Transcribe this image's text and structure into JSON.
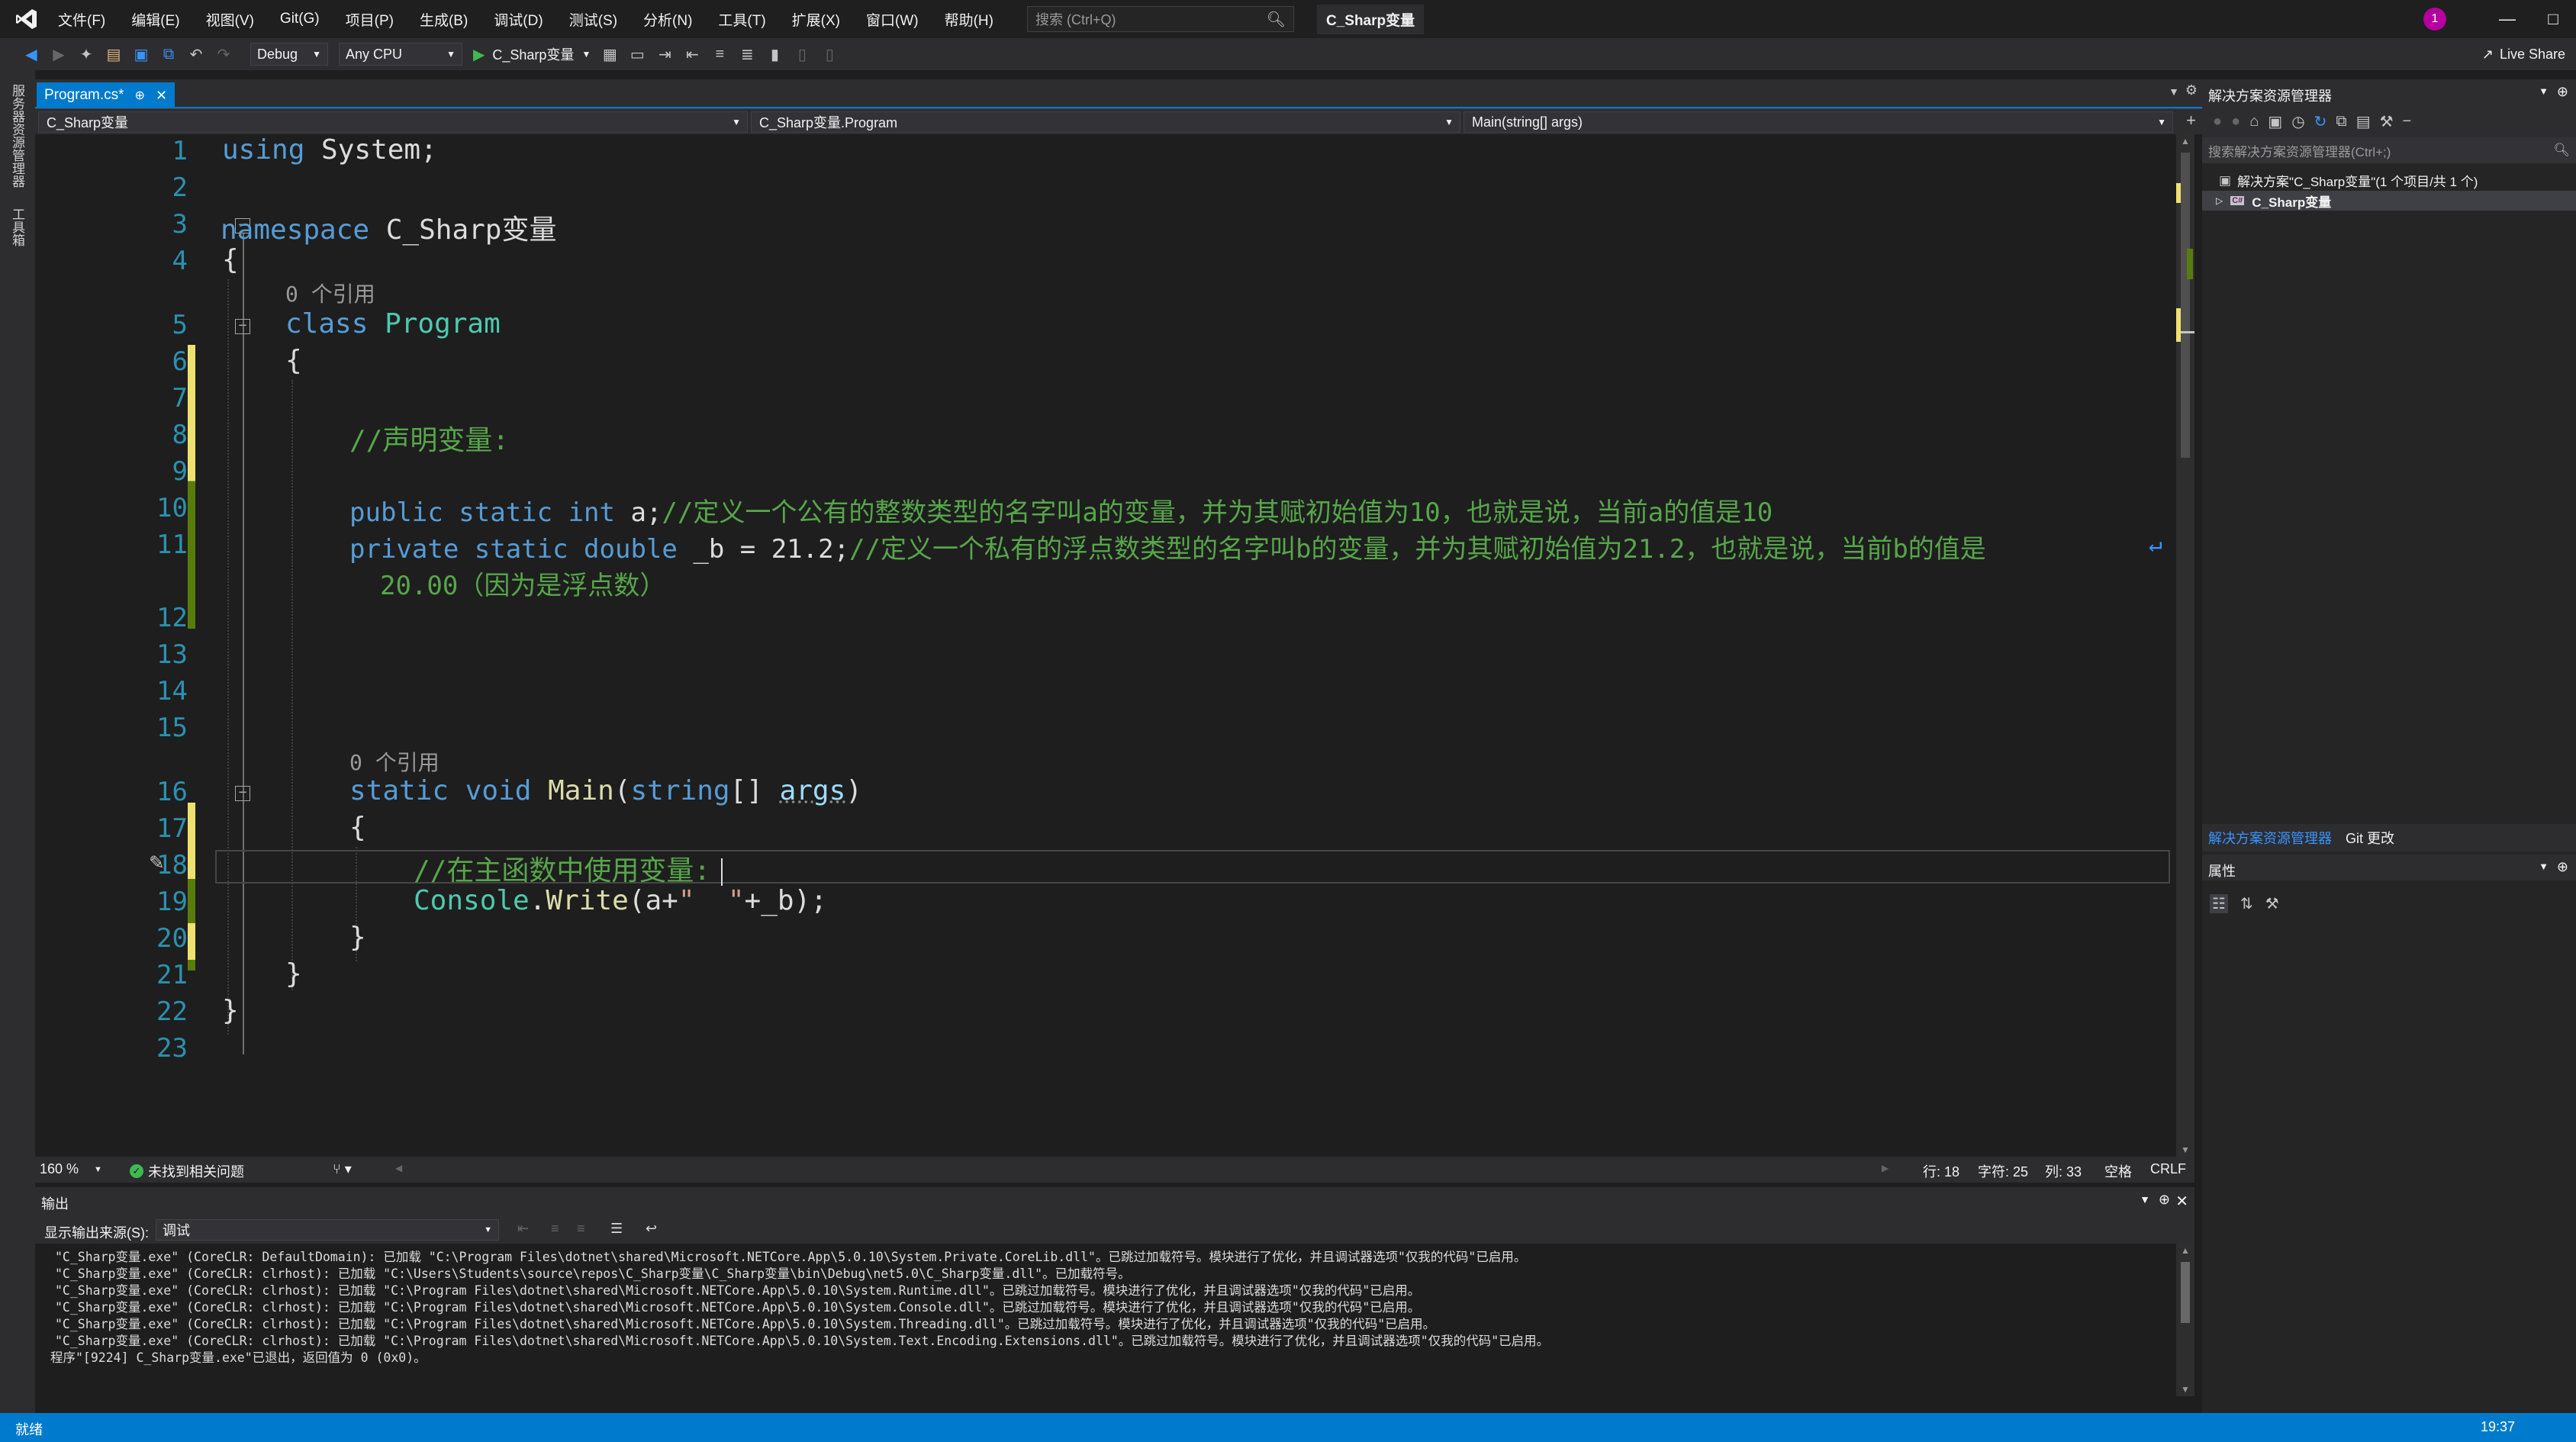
{
  "titlebar": {
    "menus": [
      "文件(F)",
      "编辑(E)",
      "视图(V)",
      "Git(G)",
      "项目(P)",
      "生成(B)",
      "调试(D)",
      "测试(S)",
      "分析(N)",
      "工具(T)",
      "扩展(X)",
      "窗口(W)",
      "帮助(H)"
    ],
    "search_placeholder": "搜索 (Ctrl+Q)",
    "solution_name": "C_Sharp变量",
    "avatar_initial": "1",
    "live_share": "Live Share"
  },
  "toolbar": {
    "config": "Debug",
    "platform": "Any CPU",
    "run_target": "C_Sharp变量"
  },
  "left_strip": {
    "tabs": [
      "服务器资源管理器",
      "工具箱"
    ]
  },
  "document": {
    "tab_label": "Program.cs*",
    "nav_project": "C_Sharp变量",
    "nav_class": "C_Sharp变量.Program",
    "nav_member": "Main(string[] args)"
  },
  "editor": {
    "line_numbers": [
      "1",
      "2",
      "3",
      "4",
      "5",
      "6",
      "7",
      "8",
      "9",
      "10",
      "11",
      "12",
      "13",
      "14",
      "15",
      "16",
      "17",
      "18",
      "19",
      "20",
      "21",
      "22",
      "23"
    ],
    "codelens_class": "0 个引用",
    "codelens_main": "0 个引用",
    "lines": {
      "l1_kw": "using",
      "l1_rest": " System;",
      "l3_kw": "namespace",
      "l3_rest": " C_Sharp变量",
      "l4": "{",
      "l5_kw": "class",
      "l5_ty": "Program",
      "l6": "{",
      "l8": "//声明变量:",
      "l10_kw": "public static int",
      "l10_var": " a;",
      "l10_cm": "//定义一个公有的整数类型的名字叫a的变量，并为其赋初始值为10，也就是说，当前a的值是10",
      "l11_kw": "private static double",
      "l11_var": " _b = 21.2;",
      "l11_cm": "//定义一个私有的浮点数类型的名字叫b的变量，并为其赋初始值为21.2，也就是说，当前b的值是",
      "l11_wrap": "20.00（因为是浮点数）",
      "l16_kw": "static void",
      "l16_fn": "Main",
      "l16_p1": "(",
      "l16_kw2": "string",
      "l16_p2": "[] ",
      "l16_pm": "args",
      "l16_p3": ")",
      "l17": "{",
      "l18": "//在主函数中使用变量:",
      "l19_ty": "Console",
      "l19_p": ".",
      "l19_fn": "Write",
      "l19_a": "(a+",
      "l19_st": "\"  \"",
      "l19_b": "+_b);",
      "l20": "}",
      "l21": "}",
      "l22": "}"
    }
  },
  "editor_status": {
    "zoom": "160 %",
    "issues": "未找到相关问题",
    "line": "行: 18",
    "char": "字符: 25",
    "col": "列: 33",
    "spaces": "空格",
    "eol": "CRLF"
  },
  "output": {
    "title": "输出",
    "source_label": "显示输出来源(S):",
    "source_value": "调试",
    "lines": [
      "\"C_Sharp变量.exe\" (CoreCLR: DefaultDomain): 已加载 \"C:\\Program Files\\dotnet\\shared\\Microsoft.NETCore.App\\5.0.10\\System.Private.CoreLib.dll\"。已跳过加载符号。模块进行了优化，并且调试器选项\"仅我的代码\"已启用。",
      "\"C_Sharp变量.exe\" (CoreCLR: clrhost): 已加载 \"C:\\Users\\Students\\source\\repos\\C_Sharp变量\\C_Sharp变量\\bin\\Debug\\net5.0\\C_Sharp变量.dll\"。已加载符号。",
      "\"C_Sharp变量.exe\" (CoreCLR: clrhost): 已加载 \"C:\\Program Files\\dotnet\\shared\\Microsoft.NETCore.App\\5.0.10\\System.Runtime.dll\"。已跳过加载符号。模块进行了优化，并且调试器选项\"仅我的代码\"已启用。",
      "\"C_Sharp变量.exe\" (CoreCLR: clrhost): 已加载 \"C:\\Program Files\\dotnet\\shared\\Microsoft.NETCore.App\\5.0.10\\System.Console.dll\"。已跳过加载符号。模块进行了优化，并且调试器选项\"仅我的代码\"已启用。",
      "\"C_Sharp变量.exe\" (CoreCLR: clrhost): 已加载 \"C:\\Program Files\\dotnet\\shared\\Microsoft.NETCore.App\\5.0.10\\System.Threading.dll\"。已跳过加载符号。模块进行了优化，并且调试器选项\"仅我的代码\"已启用。",
      "\"C_Sharp变量.exe\" (CoreCLR: clrhost): 已加载 \"C:\\Program Files\\dotnet\\shared\\Microsoft.NETCore.App\\5.0.10\\System.Text.Encoding.Extensions.dll\"。已跳过加载符号。模块进行了优化，并且调试器选项\"仅我的代码\"已启用。",
      "程序\"[9224] C_Sharp变量.exe\"已退出，返回值为 0 (0x0)。"
    ]
  },
  "solution_explorer": {
    "title": "解决方案资源管理器",
    "search_placeholder": "搜索解决方案资源管理器(Ctrl+;)",
    "solution_node": "解决方案\"C_Sharp变量\"(1 个项目/共 1 个)",
    "project_node": "C_Sharp变量",
    "tab_active": "解决方案资源管理器",
    "tab_git": "Git 更改"
  },
  "properties": {
    "title": "属性"
  },
  "statusbar": {
    "time": "19:37",
    "status": "就绪"
  },
  "colors": {
    "accent": "#007acc",
    "comment": "#57a64a",
    "keyword": "#569cd6",
    "type": "#4ec9b0",
    "linenumber": "#2b91af"
  }
}
